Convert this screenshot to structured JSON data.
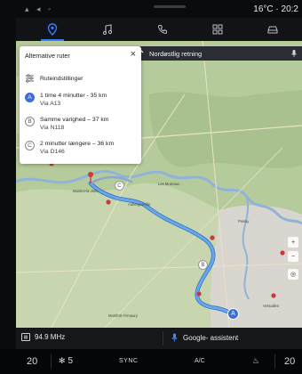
{
  "status": {
    "right_text": "16°C · 20:2"
  },
  "nav": {
    "items": [
      {
        "name": "navigation",
        "icon": "map-pin-icon"
      },
      {
        "name": "music",
        "icon": "music-note-icon"
      },
      {
        "name": "phone",
        "icon": "phone-icon"
      },
      {
        "name": "apps",
        "icon": "apps-grid-icon"
      },
      {
        "name": "vehicle",
        "icon": "car-icon"
      }
    ],
    "active": 0
  },
  "route_panel": {
    "title": "Alternative ruter",
    "close": "×",
    "settings_label": "Ruteindstillinger",
    "routes": [
      {
        "badge": "A",
        "line1": "1 time 4 minutter - 35 km",
        "line2": "Via A13"
      },
      {
        "badge": "B",
        "line1": "Samme varighed – 37 km",
        "line2": "Via N118"
      },
      {
        "badge": "C",
        "line1": "2 minutter længere – 36 km",
        "line2": "Via D146"
      }
    ]
  },
  "direction": {
    "text": "Nordøstlig retning"
  },
  "map": {
    "labels": [
      {
        "text": "Mantes-la-Jolie"
      },
      {
        "text": "Les Mureaux"
      },
      {
        "text": "Aubergenville"
      },
      {
        "text": "Poissy"
      },
      {
        "text": "Versailles"
      },
      {
        "text": "Montfort-l'Amaury"
      }
    ],
    "route_color": "#4a90e2"
  },
  "infobar": {
    "radio_icon": "radio-icon",
    "radio": "94.9 MHz",
    "assistant": "Google- assistent"
  },
  "climate": {
    "temp_left": "20",
    "fan": "5",
    "sync": "SYNC",
    "ac": "A/C",
    "temp_right": "20"
  },
  "colors": {
    "accent": "#3b7bff",
    "route": "#4a90e2",
    "map_bg": "#b9cfa1"
  }
}
